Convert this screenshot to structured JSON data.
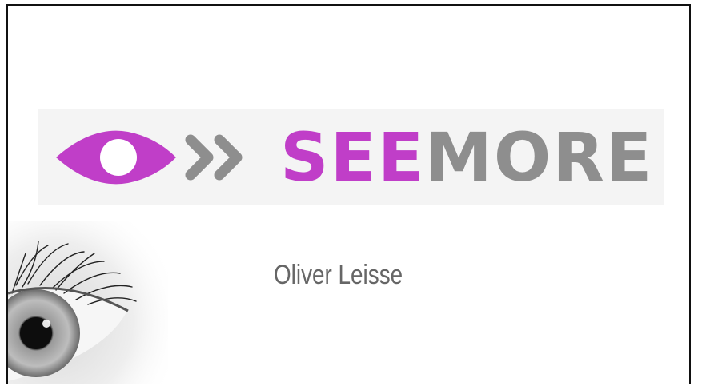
{
  "slide": {
    "brand": {
      "part1": "SEE",
      "part2": "MORE",
      "accent_color": "#c03ec8",
      "secondary_color": "#8e8e8e",
      "logo_icon": "eye-icon",
      "arrow_icon": "double-chevron-right-icon"
    },
    "presenter_name": "Oliver Leisse",
    "background_image": "eye-closeup-photo"
  }
}
